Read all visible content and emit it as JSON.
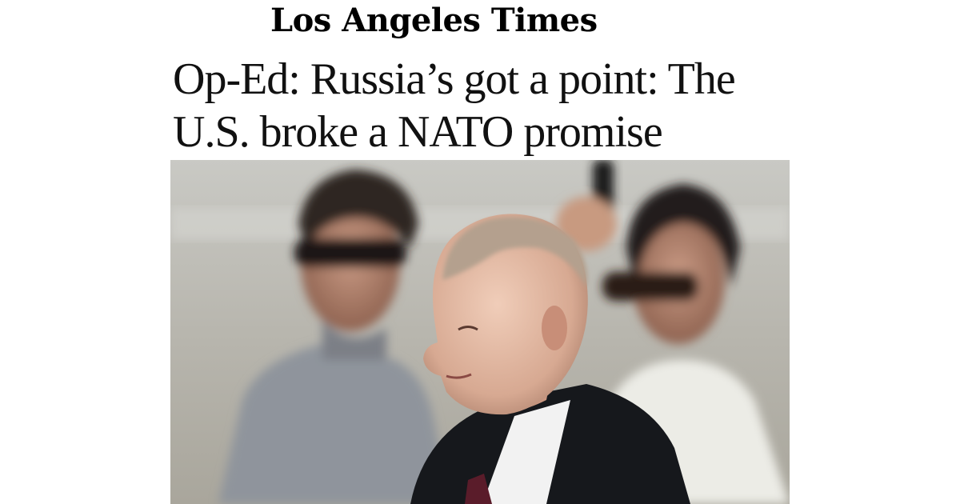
{
  "brand": {
    "masthead": "Los Angeles Times"
  },
  "article": {
    "headline": "Op-Ed: Russia’s got a point: The U.S. broke a NATO promise"
  },
  "photo": {
    "subject": "photo"
  }
}
